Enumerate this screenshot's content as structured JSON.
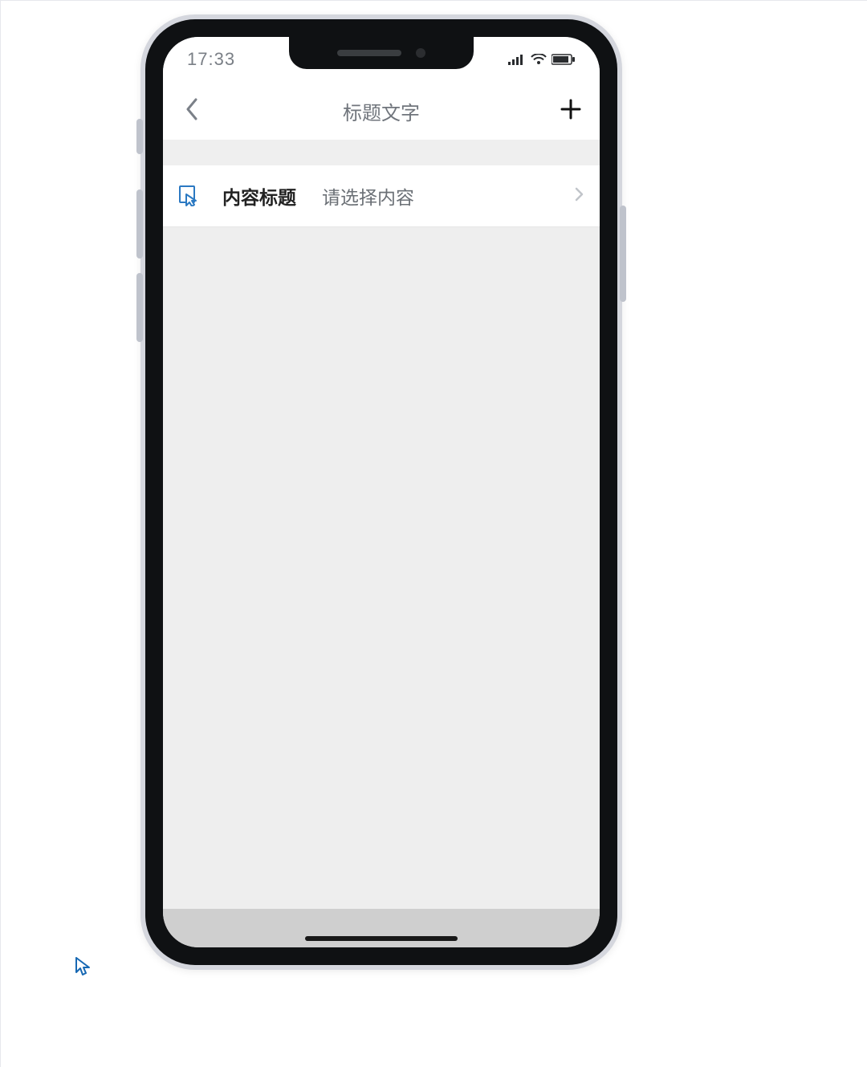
{
  "status": {
    "time": "17:33"
  },
  "nav": {
    "title": "标题文字"
  },
  "content": {
    "row": {
      "title": "内容标题",
      "value": "请选择内容"
    }
  }
}
